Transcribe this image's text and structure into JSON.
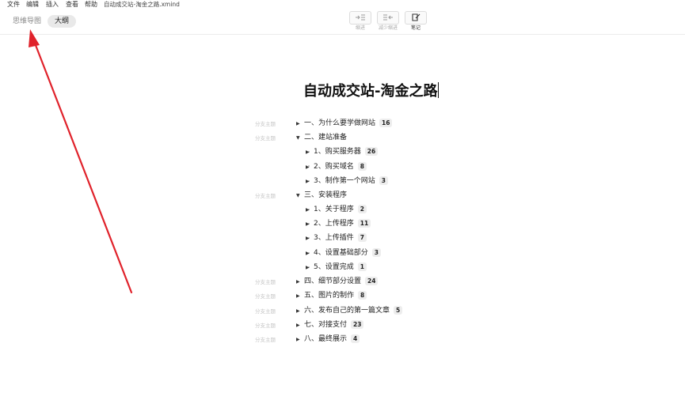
{
  "menu": [
    "文件",
    "编辑",
    "插入",
    "查看",
    "帮助"
  ],
  "file_name": "自动成交站-淘金之路.xmind",
  "tabs": {
    "mindmap": "思维导图",
    "outline": "大纲"
  },
  "toolbar": {
    "indent": "缩进",
    "outdent": "减少缩进",
    "notes": "笔记"
  },
  "document": {
    "title": "自动成交站-淘金之路",
    "placeholder": "分支主题",
    "items": [
      {
        "text": "一、为什么要学做网站",
        "count": "16"
      },
      {
        "text": "二、建站准备"
      },
      {
        "text": "1、购买服务器",
        "count": "26"
      },
      {
        "text": "2、购买域名",
        "count": "8"
      },
      {
        "text": "3、制作第一个网站",
        "count": "3"
      },
      {
        "text": "三、安装程序"
      },
      {
        "text": "1、关于程序",
        "count": "2"
      },
      {
        "text": "2、上传程序",
        "count": "11"
      },
      {
        "text": "3、上传插件",
        "count": "7"
      },
      {
        "text": "4、设置基础部分",
        "count": "3"
      },
      {
        "text": "5、设置完成",
        "count": "1"
      },
      {
        "text": "四、细节部分设置",
        "count": "24"
      },
      {
        "text": "五、图片的制作",
        "count": "8"
      },
      {
        "text": "六、发布自己的第一篇文章",
        "count": "5"
      },
      {
        "text": "七、对接支付",
        "count": "23"
      },
      {
        "text": "八、最终展示",
        "count": "4"
      }
    ]
  },
  "colors": {
    "annotation_arrow": "#e0222b",
    "active_tab_bg": "#e9e9e9"
  }
}
